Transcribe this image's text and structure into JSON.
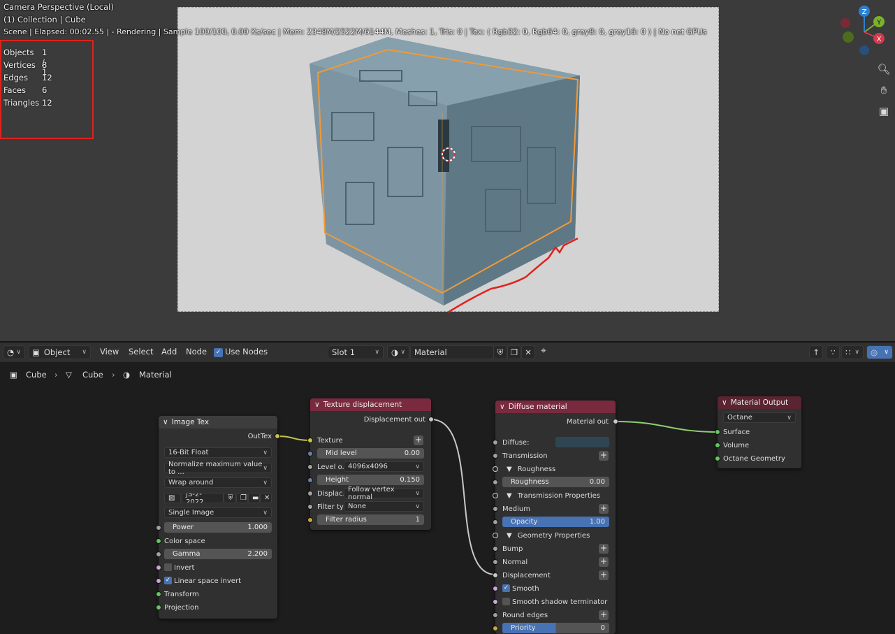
{
  "viewport": {
    "title": "Camera Perspective (Local)",
    "collection": "(1) Collection | Cube",
    "render_status": "Scene | Elapsed: 00:02.55 |  - Rendering | Sample 100/100, 0.00 Ks/sec | Mem: 2348M/2522M/6144M, Meshes: 1, Tris: 0 | Tex: ( Rgb32: 0, Rgb64: 0, grey8: 0, grey16: 0 ) | No net GPUs",
    "stats": [
      {
        "label": "Objects",
        "value": "1 / 1"
      },
      {
        "label": "Vertices",
        "value": "8"
      },
      {
        "label": "Edges",
        "value": "12"
      },
      {
        "label": "Faces",
        "value": "6"
      },
      {
        "label": "Triangles",
        "value": "12"
      }
    ],
    "gizmo": {
      "z": "Z",
      "y": "Y",
      "x": "X"
    }
  },
  "header": {
    "mode": "Object",
    "menus": [
      "View",
      "Select",
      "Add",
      "Node"
    ],
    "use_nodes_label": "Use Nodes",
    "slot": "Slot 1",
    "material": "Material"
  },
  "breadcrumb": [
    "Cube",
    "Cube",
    "Material"
  ],
  "nodes": {
    "image_tex": {
      "title": "Image Tex",
      "out": "OutTex",
      "bit_depth": "16-Bit Float",
      "normalize": "Normalize maximum value to ...",
      "wrap": "Wrap around",
      "file": "JS-2-2022...",
      "mode": "Single Image",
      "power_label": "Power",
      "power_value": "1.000",
      "color_space": "Color space",
      "gamma_label": "Gamma",
      "gamma_value": "2.200",
      "invert": "Invert",
      "linear": "Linear space invert",
      "transform": "Transform",
      "projection": "Projection"
    },
    "texture_displacement": {
      "title": "Texture displacement",
      "out": "Displacement out",
      "texture": "Texture",
      "mid_label": "Mid level",
      "mid_value": "0.00",
      "level_label": "Level o...",
      "level_value": "4096x4096",
      "height_label": "Height",
      "height_value": "0.150",
      "displace_label": "Displac...",
      "displace_value": "Follow vertex normal",
      "filter_label": "Filter ty",
      "filter_value": "None",
      "radius_label": "Filter radius",
      "radius_value": "1"
    },
    "diffuse": {
      "title": "Diffuse material",
      "out": "Material out",
      "diffuse": "Diffuse:",
      "transmission": "Transmission",
      "roughness_section": "Roughness",
      "roughness_label": "Roughness",
      "roughness_value": "0.00",
      "transmission_props": "Transmission Properties",
      "medium": "Medium",
      "opacity_label": "Opacity",
      "opacity_value": "1.00",
      "geometry_props": "Geometry Properties",
      "bump": "Bump",
      "normal": "Normal",
      "displacement": "Displacement",
      "smooth": "Smooth",
      "smooth_shadow": "Smooth shadow terminator",
      "round_edges": "Round edges",
      "priority_label": "Priority",
      "priority_value": "0"
    },
    "material_output": {
      "title": "Material Output",
      "renderer": "Octane",
      "surface": "Surface",
      "volume": "Volume",
      "geometry": "Octane Geometry"
    }
  },
  "colors": {
    "accent": "#4772b3",
    "shader_header": "#7a2a3e",
    "output_header": "#5a2430",
    "highlight": "#e0211d",
    "selection": "#f09a38"
  }
}
